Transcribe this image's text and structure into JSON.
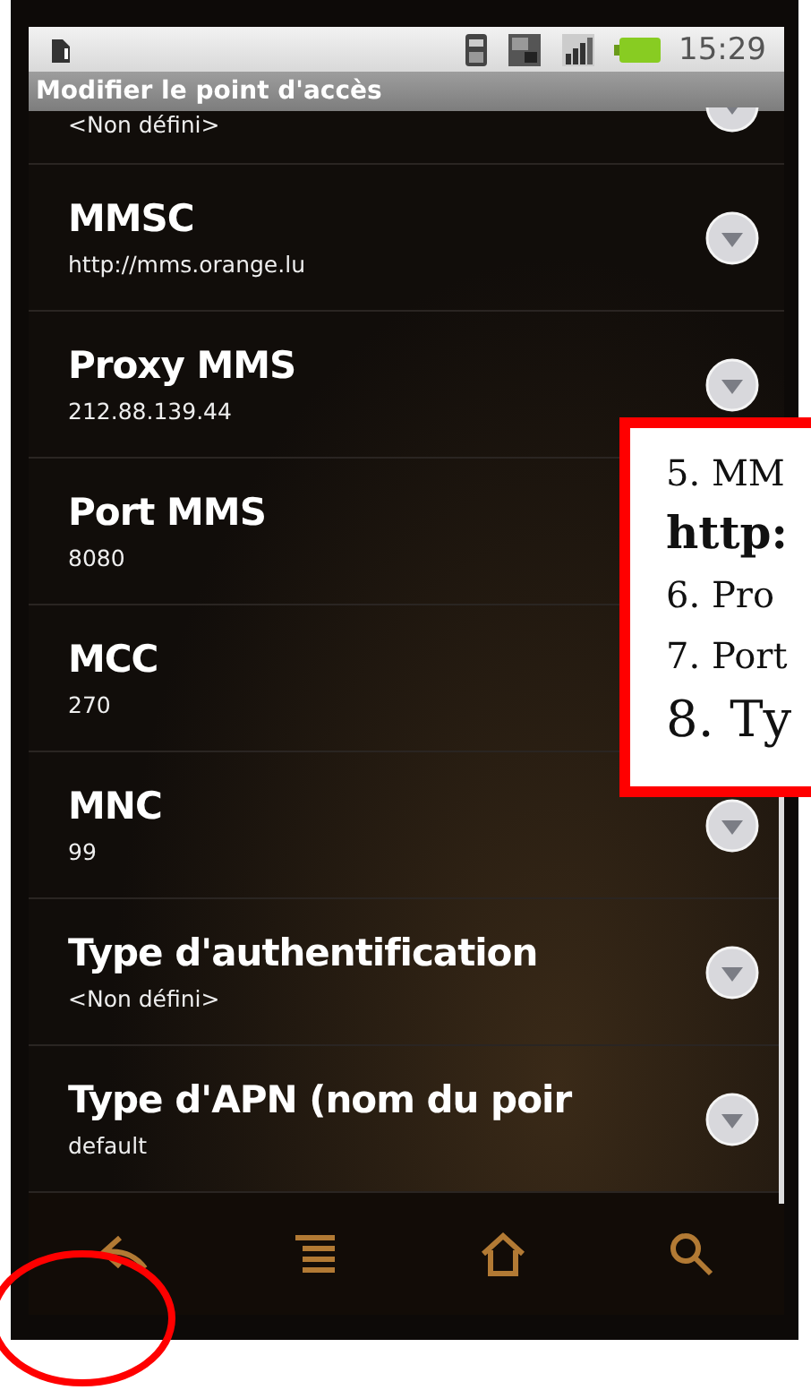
{
  "status_bar": {
    "time": "15:29"
  },
  "title": "Modifier le point d'accès",
  "settings": [
    {
      "kind": "partial",
      "summary": "<Non défini>"
    },
    {
      "kind": "full",
      "title": "MMSC",
      "summary": "http://mms.orange.lu"
    },
    {
      "kind": "full",
      "title": "Proxy MMS",
      "summary": "212.88.139.44"
    },
    {
      "kind": "full",
      "title": "Port MMS",
      "summary": "8080"
    },
    {
      "kind": "full",
      "title": "MCC",
      "summary": "270"
    },
    {
      "kind": "full",
      "title": "MNC",
      "summary": "99"
    },
    {
      "kind": "full",
      "title": "Type d'authentification",
      "summary": "<Non défini>"
    },
    {
      "kind": "full",
      "title": "Type d'APN (nom du poir",
      "summary": "default"
    }
  ],
  "annotation": {
    "lines": [
      {
        "kind": "step",
        "text": "5. MM"
      },
      {
        "kind": "link",
        "text": "http:"
      },
      {
        "kind": "step",
        "text": "6. Pro"
      },
      {
        "kind": "step",
        "text": "7. Port"
      },
      {
        "kind": "large",
        "text": "8. Ty"
      }
    ]
  }
}
